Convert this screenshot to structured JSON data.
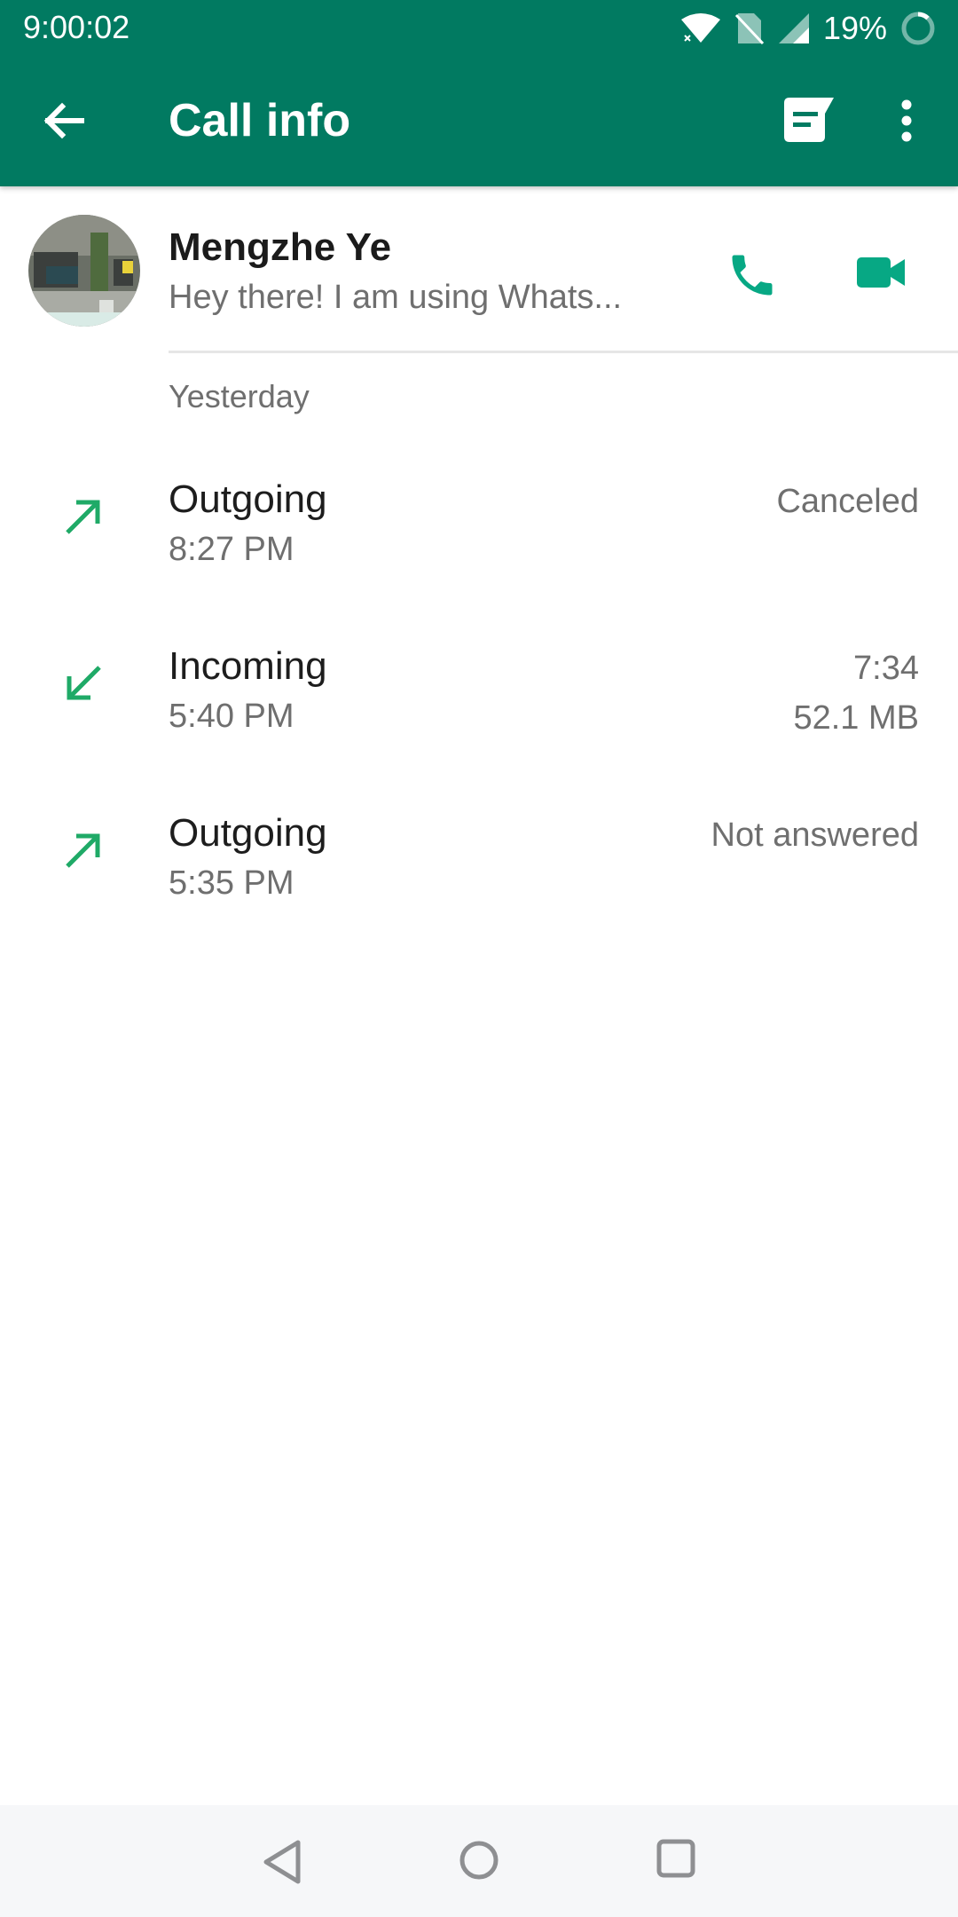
{
  "status_bar": {
    "time": "9:00:02",
    "battery": "19%"
  },
  "toolbar": {
    "title": "Call info"
  },
  "contact": {
    "name": "Mengzhe Ye",
    "status": "Hey there! I am using Whats..."
  },
  "section": {
    "header": "Yesterday"
  },
  "calls": [
    {
      "type": "Outgoing",
      "time": "8:27 PM",
      "status": "Canceled",
      "size": "",
      "direction": "outgoing"
    },
    {
      "type": "Incoming",
      "time": "5:40 PM",
      "status": "7:34",
      "size": "52.1 MB",
      "direction": "incoming"
    },
    {
      "type": "Outgoing",
      "time": "5:35 PM",
      "status": "Not answered",
      "size": "",
      "direction": "outgoing"
    }
  ],
  "colors": {
    "primary": "#017a61",
    "accent": "#1faa67",
    "icon_teal": "#07a884"
  }
}
